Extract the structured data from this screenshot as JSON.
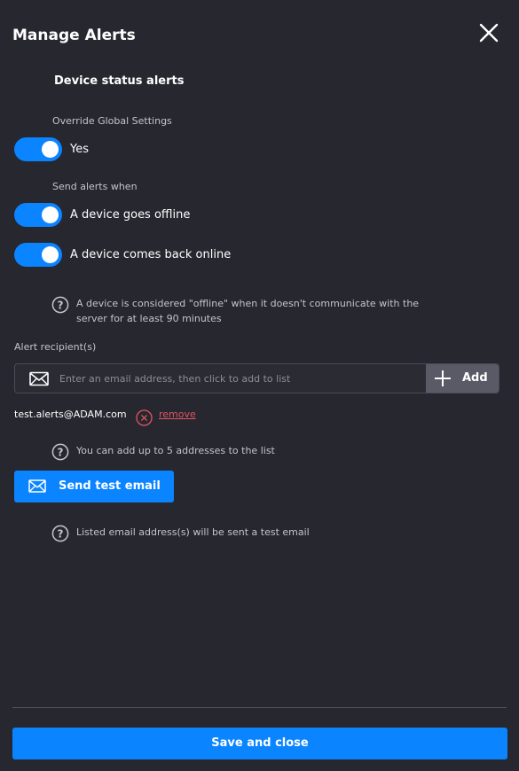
{
  "dialog": {
    "title": "Manage Alerts",
    "close_icon": "close-icon"
  },
  "section": {
    "heading": "Device status alerts"
  },
  "override": {
    "label": "Override Global Settings",
    "toggle_on": true,
    "value_label": "Yes"
  },
  "send_alerts": {
    "label": "Send alerts when",
    "options": [
      {
        "label": "A device goes offline",
        "enabled": true
      },
      {
        "label": "A device comes back online",
        "enabled": true
      }
    ]
  },
  "offline_help": {
    "icon": "help-circle-icon",
    "line1": "A device is considered \"offline\" when it doesn't communicate with the",
    "line2": "server for at least 90 minutes"
  },
  "recipients": {
    "label": "Alert recipient(s)",
    "input": {
      "icon": "envelope-icon",
      "value": "",
      "placeholder": "Enter an email address, then click to add to list"
    },
    "add_button": {
      "icon": "plus-icon",
      "label": "Add"
    },
    "list": [
      {
        "email": "test.alerts@ADAM.com",
        "remove_icon": "remove-circle-icon",
        "remove_label": "remove"
      }
    ],
    "limit_help": "You can add up to 5 addresses to the list"
  },
  "test_email": {
    "icon": "envelope-icon",
    "label": "Send test email",
    "help": "Listed email address(s) will be sent a test email"
  },
  "footer": {
    "save_label": "Save and close"
  },
  "colors": {
    "background": "#272730",
    "accent": "#0a84ff",
    "danger": "#e0555f",
    "muted_text": "#c4c4cc"
  }
}
